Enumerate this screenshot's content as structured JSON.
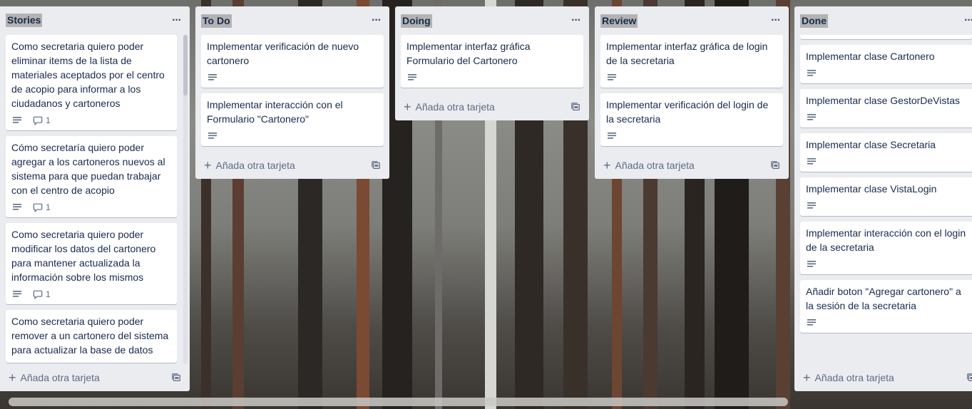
{
  "board": {
    "lists": [
      {
        "title": "Stories",
        "menu": "···",
        "cards": [
          {
            "title": "Como secretaria quiero poder eliminar items de la lista de materiales aceptados por el centro de acopio para informar a los ciudadanos y cartoneros",
            "comments": "1"
          },
          {
            "title": "Cómo secretaría quiero poder agregar a los cartoneros nuevos al sistema para que puedan trabajar con el centro de acopio",
            "comments": "1"
          },
          {
            "title": "Como secretaria quiero poder modificar los datos del cartonero para mantener actualizada la información sobre los mismos",
            "comments": "1"
          },
          {
            "title": "Como secretaria quiero poder remover a un cartonero del sistema para actualizar la base de datos",
            "comments": ""
          }
        ],
        "add_label": "Añada otra tarjeta"
      },
      {
        "title": "To Do",
        "menu": "···",
        "cards": [
          {
            "title": "Implementar verificación de nuevo cartonero"
          },
          {
            "title": "Implementar interacción con el Formulario \"Cartonero\""
          }
        ],
        "add_label": "Añada otra tarjeta"
      },
      {
        "title": "Doing",
        "menu": "···",
        "cards": [
          {
            "title": "Implementar interfaz gráfica Formulario del Cartonero"
          }
        ],
        "add_label": "Añada otra tarjeta"
      },
      {
        "title": "Review",
        "menu": "···",
        "cards": [
          {
            "title": "Implementar interfaz gráfica de login de la secretaria"
          },
          {
            "title": "Implementar verificación del login de la secretaria"
          }
        ],
        "add_label": "Añada otra tarjeta"
      },
      {
        "title": "Done",
        "menu": "···",
        "cards": [
          {
            "title": "Implementar clase Cartonero"
          },
          {
            "title": "Implementar clase GestorDeVistas"
          },
          {
            "title": "Implementar clase Secretaria"
          },
          {
            "title": "Implementar clase VistaLogin"
          },
          {
            "title": "Implementar interacción con el login de la secretaria"
          },
          {
            "title": "Añadir boton \"Agregar cartonero\" a la sesión de la secretaria"
          }
        ],
        "add_label": "Añada otra tarjeta"
      }
    ]
  },
  "icons": {
    "description": "description-icon",
    "comment": "comment-icon",
    "template": "card-template-icon",
    "menu": "ellipsis-icon",
    "add": "plus-icon"
  },
  "colors": {
    "list_bg": "#ebecf0",
    "card_bg": "#ffffff",
    "text": "#172b4d",
    "muted": "#5e6c84"
  }
}
